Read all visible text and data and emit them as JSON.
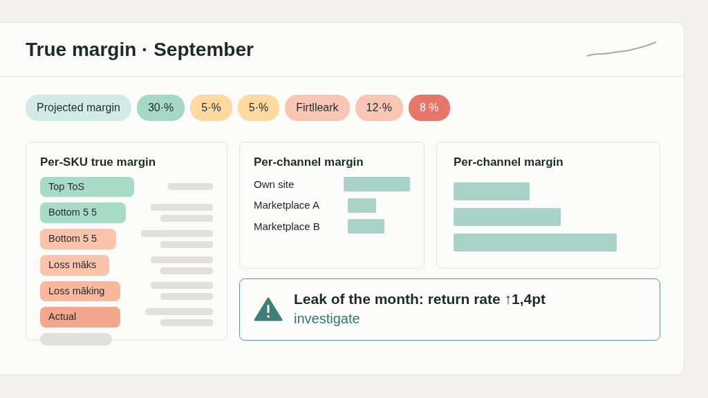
{
  "header": {
    "title": "True margin · September"
  },
  "chips": [
    {
      "label": "Projected margin",
      "color": "#d3ebe6"
    },
    {
      "label": "30·%",
      "color": "#a6d8c6"
    },
    {
      "label": "5·%",
      "color": "#fdd99f"
    },
    {
      "label": "5·%",
      "color": "#fdd99f"
    },
    {
      "label": "Firtlleark",
      "color": "#f9c6b6"
    },
    {
      "label": "12·%",
      "color": "#f9c6b6"
    },
    {
      "label": "8 %",
      "color": "#e8756a"
    }
  ],
  "sku_card": {
    "title": "Per-SKU true margin",
    "items": [
      {
        "label": "Top ToS",
        "color": "#a8dac8"
      },
      {
        "label": "Bottom 5 5",
        "color": "#a8dac8"
      },
      {
        "label": "Bottom 5 5",
        "color": "#fbc3aa"
      },
      {
        "label": "Loss māks",
        "color": "#fbc3aa"
      },
      {
        "label": "Loss māking",
        "color": "#f9b79e"
      },
      {
        "label": "Actual",
        "color": "#f4a78d"
      }
    ]
  },
  "channel_card": {
    "title": "Per-channel margin",
    "channels": [
      {
        "name": "Own site"
      },
      {
        "name": "Marketplace A"
      },
      {
        "name": "Marketplace B"
      }
    ]
  },
  "channel_card_2": {
    "title": "Per-channel margin"
  },
  "alert": {
    "text": "Leak of the month: return rate ↑1,4pt",
    "link": "investigate"
  }
}
